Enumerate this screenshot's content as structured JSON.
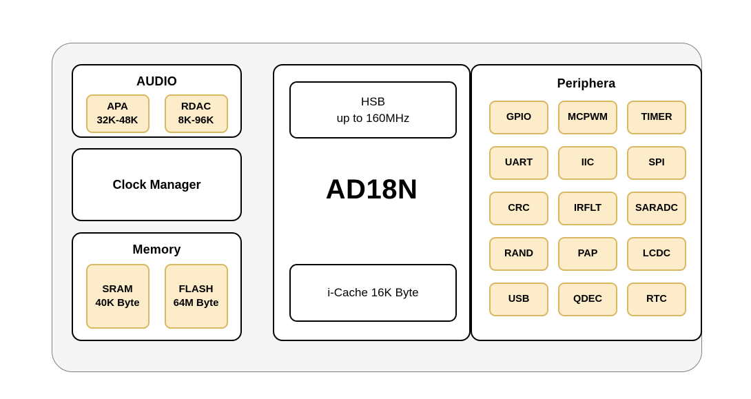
{
  "diagram": {
    "title": "AD18N SoC block diagram",
    "colors": {
      "chassis_fill": "#f5f5f5",
      "chassis_border": "#808080",
      "panel_fill": "#ffffff",
      "panel_border": "#000000",
      "chip_fill": "#fcecc9",
      "chip_border": "#d9b863",
      "text": "#000000"
    }
  },
  "left_column": {
    "audio": {
      "title": "AUDIO",
      "blocks": [
        {
          "line1": "APA",
          "line2": "32K-48K"
        },
        {
          "line1": "RDAC",
          "line2": "8K-96K"
        }
      ]
    },
    "clock": {
      "title": "Clock Manager"
    },
    "memory": {
      "title": "Memory",
      "blocks": [
        {
          "line1": "SRAM",
          "line2": "40K Byte"
        },
        {
          "line1": "FLASH",
          "line2": "64M Byte"
        }
      ]
    }
  },
  "center_column": {
    "bus": {
      "line1": "HSB",
      "line2": "up to 160MHz"
    },
    "cpu_name": "AD18N",
    "cache": {
      "label": "i-Cache 16K Byte"
    }
  },
  "peripheral_column": {
    "title": "Periphera",
    "blocks": [
      "GPIO",
      "MCPWM",
      "TIMER",
      "UART",
      "IIC",
      "SPI",
      "CRC",
      "IRFLT",
      "SARADC",
      "RAND",
      "PAP",
      "LCDC",
      "USB",
      "QDEC",
      "RTC"
    ]
  }
}
